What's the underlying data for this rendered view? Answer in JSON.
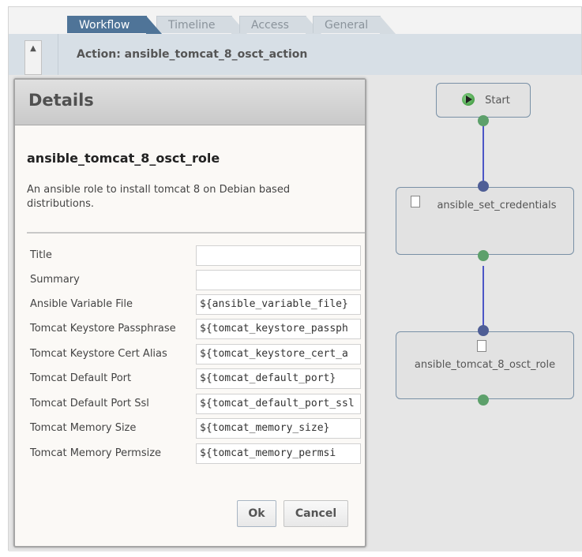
{
  "tabs": [
    {
      "label": "Workflow",
      "active": true
    },
    {
      "label": "Timeline",
      "active": false
    },
    {
      "label": "Access",
      "active": false
    },
    {
      "label": "General",
      "active": false
    }
  ],
  "action_bar": {
    "title": "Action: ansible_tomcat_8_osct_action",
    "scroll_icon": "triangle-up"
  },
  "dialog": {
    "title": "Details",
    "role_name": "ansible_tomcat_8_osct_role",
    "role_description": "An ansible role to install tomcat 8 on Debian based distributions.",
    "fields": [
      {
        "label": "Title",
        "value": ""
      },
      {
        "label": "Summary",
        "value": ""
      },
      {
        "label": "Ansible Variable File",
        "value": "${ansible_variable_file}"
      },
      {
        "label": "Tomcat Keystore Passphrase",
        "value": "${tomcat_keystore_passph"
      },
      {
        "label": "Tomcat Keystore Cert Alias",
        "value": "${tomcat_keystore_cert_a"
      },
      {
        "label": "Tomcat Default Port",
        "value": "${tomcat_default_port}"
      },
      {
        "label": "Tomcat Default Port Ssl",
        "value": "${tomcat_default_port_ssl"
      },
      {
        "label": "Tomcat Memory Size",
        "value": "${tomcat_memory_size}"
      },
      {
        "label": "Tomcat Memory Permsize",
        "value": "${tomcat_memory_permsi"
      }
    ],
    "ok_label": "Ok",
    "cancel_label": "Cancel"
  },
  "workflow": {
    "nodes": [
      {
        "label": "Start",
        "icon": "start-icon"
      },
      {
        "label": "ansible_set_credentials",
        "icon": "document-icon"
      },
      {
        "label": "ansible_tomcat_8_osct_role",
        "icon": "document-icon"
      }
    ]
  },
  "colors": {
    "active_tab": "#4f7498",
    "connector": "#4d56c6",
    "output_port": "#5da06b",
    "input_port": "#4f5e96"
  }
}
